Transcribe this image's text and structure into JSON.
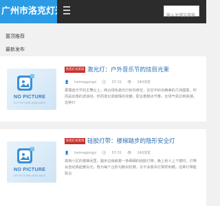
{
  "header": {
    "site_title": "广州市洛克灯光设",
    "search_placeholder": "输入关键字搜索"
  },
  "nav": {
    "item1": "置顶推荐",
    "item2": "最新发布"
  },
  "posts": [
    {
      "tag": "洛克灯光资讯",
      "title": "激光灯：户外音乐节的炫目光束",
      "author": "heimagongsi",
      "date": "07-31",
      "views": "240浏览",
      "excerpt": "幕霭音乐节的主舞台上，两台绿色激光灯射向夜空，在空中织出精美的几何图案，时而是动感的波浪线，时而变幻成璀璨的花瓣，配合着鼓点节奏，全场气氛达到高潮。这种灯",
      "image_text": "NO PICTURE",
      "image_subtext": "NO PICTURE AVAILABLE"
    },
    {
      "tag": "洛克灯光资讯",
      "title": "硅胶灯带：楼梯踏步的隐形安全灯",
      "author": "heimagongsi",
      "date": "07-31",
      "views": "240浏览",
      "excerpt": "高档小区的楼梯间里，踏步边缘嵌着一条细细的硅胶灯带，晚上有人上下楼时，灯带会自动亮起暖白光，既为每个台阶勾勒出轮廓，又不会像吊灯那样刺眼。这种灯带能贴合",
      "image_text": "NO PICTURE",
      "image_subtext": "NO PICTURE AVAILABLE"
    }
  ]
}
